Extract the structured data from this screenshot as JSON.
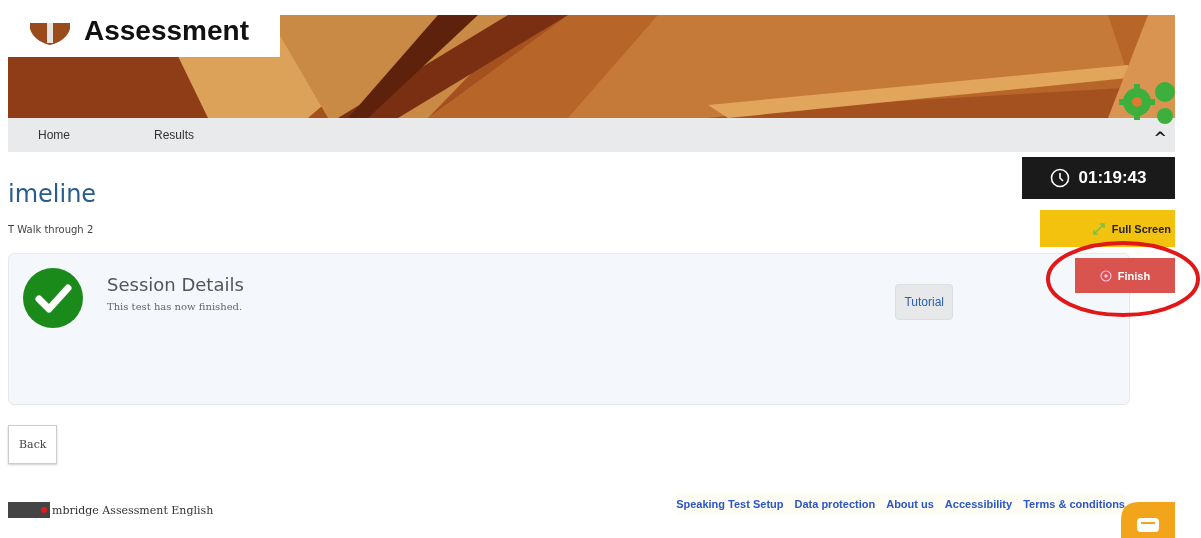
{
  "header": {
    "logo_text": "Assessment"
  },
  "nav": {
    "items": [
      {
        "label": "Home"
      },
      {
        "label": "Results"
      }
    ],
    "collapse_glyph": "^"
  },
  "widgets": {
    "timer": "01:19:43",
    "full_screen": "Full Screen",
    "finish": "Finish"
  },
  "page": {
    "title": "imeline",
    "subtitle": "T Walk through 2"
  },
  "session": {
    "title": "Session Details",
    "status": "This test has now finished.",
    "completed": true,
    "button": "Tutorial"
  },
  "back_button": "Back",
  "footer": {
    "brand": "mbridge Assessment English",
    "links": [
      "Speaking Test Setup",
      "Data protection",
      "About us",
      "Accessibility",
      "Terms & conditions"
    ]
  }
}
